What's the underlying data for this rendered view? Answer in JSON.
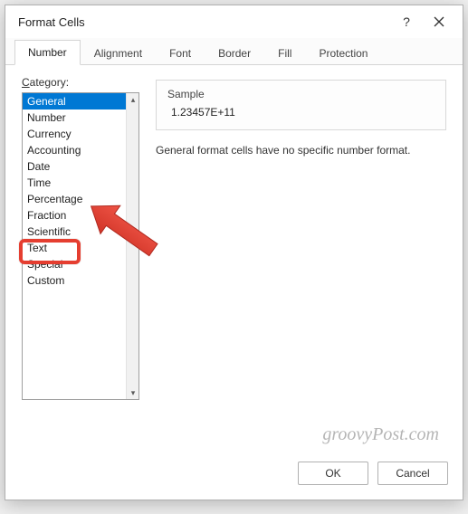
{
  "dialog": {
    "title": "Format Cells"
  },
  "tabs": [
    {
      "label": "Number",
      "active": true
    },
    {
      "label": "Alignment",
      "active": false
    },
    {
      "label": "Font",
      "active": false
    },
    {
      "label": "Border",
      "active": false
    },
    {
      "label": "Fill",
      "active": false
    },
    {
      "label": "Protection",
      "active": false
    }
  ],
  "category": {
    "label_prefix": "C",
    "label_rest": "ategory:",
    "items": [
      "General",
      "Number",
      "Currency",
      "Accounting",
      "Date",
      "Time",
      "Percentage",
      "Fraction",
      "Scientific",
      "Text",
      "Special",
      "Custom"
    ],
    "selected_index": 0,
    "highlighted_index": 11
  },
  "sample": {
    "title": "Sample",
    "value": "1.23457E+11"
  },
  "description": "General format cells have no specific number format.",
  "buttons": {
    "ok": "OK",
    "cancel": "Cancel"
  },
  "watermark": "groovyPost.com",
  "annotation": {
    "arrow_color": "#e53e30"
  }
}
